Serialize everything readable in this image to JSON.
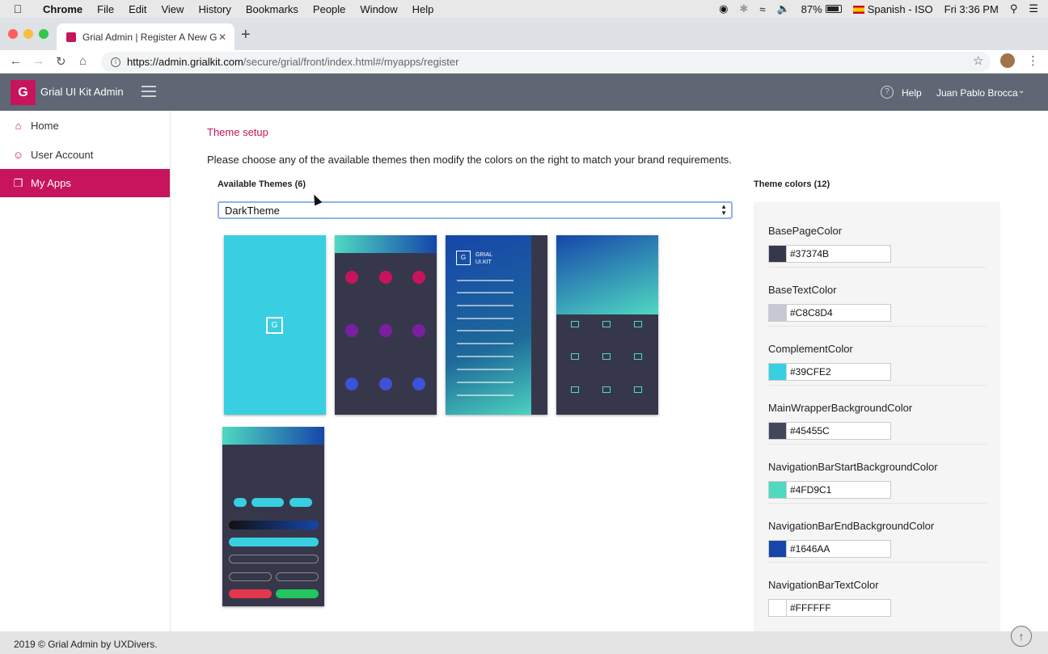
{
  "mac_menubar": {
    "apple_icon": "apple-icon",
    "app_name": "Chrome",
    "menus": [
      "File",
      "Edit",
      "View",
      "History",
      "Bookmarks",
      "People",
      "Window",
      "Help"
    ],
    "battery": "87%",
    "input_source": "Spanish - ISO",
    "clock": "Fri 3:36 PM"
  },
  "browser": {
    "tab_title": "Grial Admin | Register A New G",
    "new_tab": "+",
    "url_host": "https://admin.grialkit.com",
    "url_path": "/secure/grial/front/index.html#/myapps/register"
  },
  "header": {
    "logo_glyph": "G",
    "title": "Grial UI Kit Admin",
    "help": "Help",
    "user": "Juan Pablo Brocca"
  },
  "sidebar": {
    "items": [
      {
        "label": "Home",
        "icon": "home-icon",
        "active": false
      },
      {
        "label": "User Account",
        "icon": "user-icon",
        "active": false
      },
      {
        "label": "My Apps",
        "icon": "apps-icon",
        "active": true
      }
    ]
  },
  "main": {
    "section_title": "Theme setup",
    "description": "Please choose any of the available themes then modify the colors on the right to match your brand requirements.",
    "available_label": "Available Themes (6)",
    "selected_theme": "DarkTheme",
    "colors_label": "Theme colors (12)"
  },
  "theme_colors": [
    {
      "name": "BasePageColor",
      "value": "#37374B",
      "swatch": "#37374b"
    },
    {
      "name": "BaseTextColor",
      "value": "#C8C8D4",
      "swatch": "#c8c8d4"
    },
    {
      "name": "ComplementColor",
      "value": "#39CFE2",
      "swatch": "#39cfe2"
    },
    {
      "name": "MainWrapperBackgroundColor",
      "value": "#45455C",
      "swatch": "#45455c"
    },
    {
      "name": "NavigationBarStartBackgroundColor",
      "value": "#4FD9C1",
      "swatch": "#4fd9c1"
    },
    {
      "name": "NavigationBarEndBackgroundColor",
      "value": "#1646AA",
      "swatch": "#1646aa"
    },
    {
      "name": "NavigationBarTextColor",
      "value": "#FFFFFF",
      "swatch": "#ffffff"
    }
  ],
  "footer": {
    "text": "2019 © Grial Admin by UXDivers."
  },
  "accent": "#c8145c"
}
